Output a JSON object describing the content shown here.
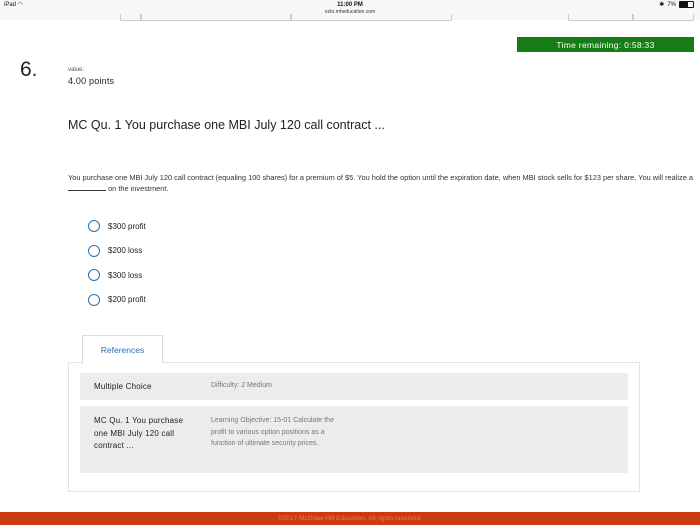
{
  "status_bar": {
    "device": "iPad",
    "time": "11:00 PM",
    "url": "ezto.mheducation.com",
    "battery": "7%"
  },
  "timer": {
    "text": "Time remaining: 0:58:33"
  },
  "question": {
    "number": "6.",
    "value_label": "value:",
    "points": "4.00 points",
    "title": "MC Qu. 1 You purchase one MBI July 120 call contract ...",
    "text_before": "You purchase one MBI July 120 call contract (equaling 100 shares) for a premium of $5. You hold the option until the expiration date, when MBI stock sells for $123 per share. You will realize a",
    "text_after": "on the investment.",
    "options": [
      "$300 profit",
      "$200 loss",
      "$300 loss",
      "$200 profit"
    ]
  },
  "references": {
    "tab_label": "References",
    "rows": [
      {
        "key": "Multiple Choice",
        "value": "Difficulty: 2 Medium"
      },
      {
        "key": "MC Qu. 1 You purchase one MBI July 120 call contract ...",
        "value": "Learning Objective: 15-01 Calculate the profit to various option positions as a function of ultimate security prices."
      }
    ]
  },
  "footer": {
    "text": "©2017 McGraw-Hill Education. All rights reserved."
  },
  "colors": {
    "timer_bg": "#167c13",
    "footer_bg": "#cc3a12",
    "accent": "#2a6fb3"
  }
}
